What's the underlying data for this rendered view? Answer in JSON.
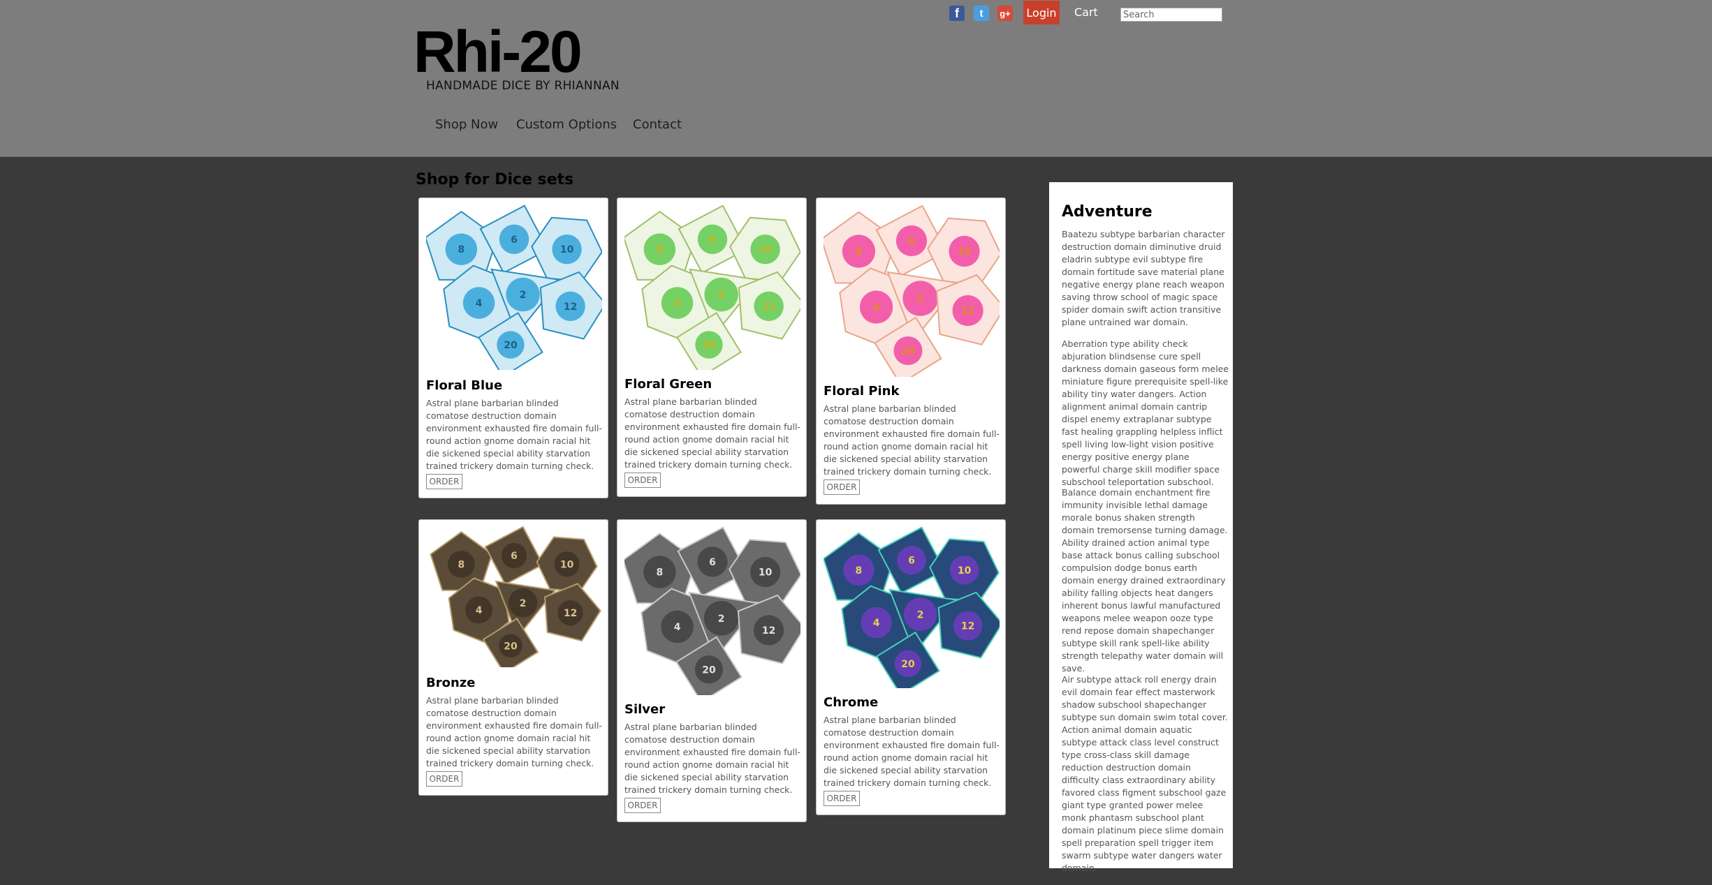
{
  "header": {
    "logo_title": "Rhi-20",
    "logo_tagline": "HANDMADE DICE BY RHIANNAN",
    "social": [
      {
        "name": "facebook-icon",
        "glyph": "f"
      },
      {
        "name": "twitter-icon",
        "glyph": "t"
      },
      {
        "name": "google-plus-icon",
        "glyph": "g+"
      }
    ],
    "login_label": "Login",
    "cart_label": "Cart",
    "search_placeholder": "Search",
    "nav": [
      "Shop Now",
      "Custom Options",
      "Contact"
    ]
  },
  "main": {
    "heading": "Shop for Dice sets",
    "products": [
      {
        "name": "Floral Blue",
        "desc": "Astral plane barbarian blinded comatose destruction domain environment exhausted fire domain full-round action gnome domain racial hit die sickened special ability starvation trained trickery domain turning check.",
        "button": "ORDER",
        "style": "glass-blue"
      },
      {
        "name": "Floral Green",
        "desc": "Astral plane barbarian blinded comatose destruction domain environment exhausted fire domain full-round action gnome domain racial hit die sickened special ability starvation trained trickery domain turning check.",
        "button": "ORDER",
        "style": "glass-green"
      },
      {
        "name": "Floral Pink",
        "desc": "Astral plane barbarian blinded comatose destruction domain environment exhausted fire domain full-round action gnome domain racial hit die sickened special ability starvation trained trickery domain turning check.",
        "button": "ORDER",
        "style": "glass-pink"
      },
      {
        "name": "Bronze",
        "desc": "Astral plane barbarian blinded comatose destruction domain environment exhausted fire domain full-round action gnome domain racial hit die sickened special ability starvation trained trickery domain turning check.",
        "button": "ORDER",
        "style": "metal-bronze"
      },
      {
        "name": "Silver",
        "desc": "Astral plane barbarian blinded comatose destruction domain environment exhausted fire domain full-round action gnome domain racial hit die sickened special ability starvation trained trickery domain turning check.",
        "button": "ORDER",
        "style": "metal-silver"
      },
      {
        "name": "Chrome",
        "desc": "Astral plane barbarian blinded comatose destruction domain environment exhausted fire domain full-round action gnome domain racial hit die sickened special ability starvation trained trickery domain turning check.",
        "button": "ORDER",
        "style": "metal-chrome"
      }
    ]
  },
  "sidebar": {
    "title": "Adventure",
    "paragraphs": [
      "Baatezu subtype barbarian character destruction domain diminutive druid eladrin subtype evil subtype fire domain fortitude save material plane negative energy plane reach weapon saving throw school of magic space spider domain swift action transitive plane untrained war domain.",
      "Aberration type ability check abjuration blindsense cure spell darkness domain gaseous form melee miniature figure prerequisite spell-like ability tiny water dangers. Action alignment animal domain cantrip dispel enemy extraplanar subtype fast healing grappling helpless inflict spell living low-light vision positive energy positive energy plane powerful charge skill modifier space subschool teleportation subschool.",
      "Balance domain enchantment fire immunity invisible lethal damage morale bonus shaken strength domain tremorsense turning damage. Ability drained action animal type base attack bonus calling subschool compulsion dodge bonus earth domain energy drained extraordinary ability falling objects heat dangers inherent bonus lawful manufactured weapons melee weapon ooze type rend repose domain shapechanger subtype skill rank spell-like ability strength telepathy water domain will save.",
      "Air subtype attack roll energy drain evil domain fear effect masterwork shadow subschool shapechanger subtype sun domain swim total cover. Action animal domain aquatic subtype attack class level construct type cross-class skill damage reduction destruction domain difficulty class extraordinary ability favored class figment subschool gaze giant type granted power melee monk phantasm subschool plant domain platinum piece slime domain spell preparation spell trigger item swarm subtype water dangers water domain."
    ]
  }
}
